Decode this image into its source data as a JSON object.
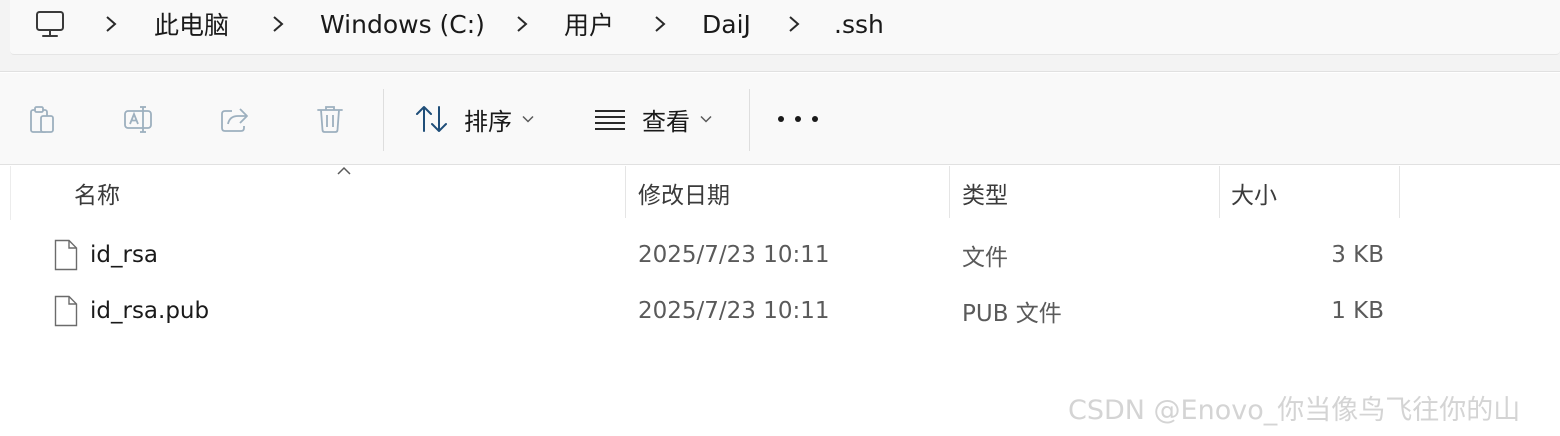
{
  "breadcrumb": {
    "items": [
      {
        "label": "此电脑"
      },
      {
        "label": "Windows (C:)"
      },
      {
        "label": "用户"
      },
      {
        "label": "DaiJ"
      },
      {
        "label": ".ssh"
      }
    ]
  },
  "icons": {
    "pc": "monitor-icon",
    "separator": "chevron-right-icon",
    "paste": "clipboard-icon",
    "rename": "rename-icon",
    "share": "share-icon",
    "delete": "trash-icon",
    "sort": "sort-icon",
    "view": "list-view-icon",
    "more": "more-icon",
    "file": "file-icon"
  },
  "toolbar": {
    "sort_label": "排序",
    "view_label": "查看"
  },
  "columns": {
    "name": "名称",
    "modified": "修改日期",
    "type": "类型",
    "size": "大小"
  },
  "files": [
    {
      "name": "id_rsa",
      "modified": "2025/7/23 10:11",
      "type": "文件",
      "size": "3 KB"
    },
    {
      "name": "id_rsa.pub",
      "modified": "2025/7/23 10:11",
      "type": "PUB 文件",
      "size": "1 KB"
    }
  ],
  "watermark": "CSDN @Enovo_你当像鸟飞往你的山",
  "colors": {
    "chrome_bg": "#f3f3f3",
    "toolbar_bg": "#f9f9f9",
    "disabled_icon": "#9db0bf",
    "text": "#1a1a1a",
    "muted_text": "#5a5a5a"
  }
}
